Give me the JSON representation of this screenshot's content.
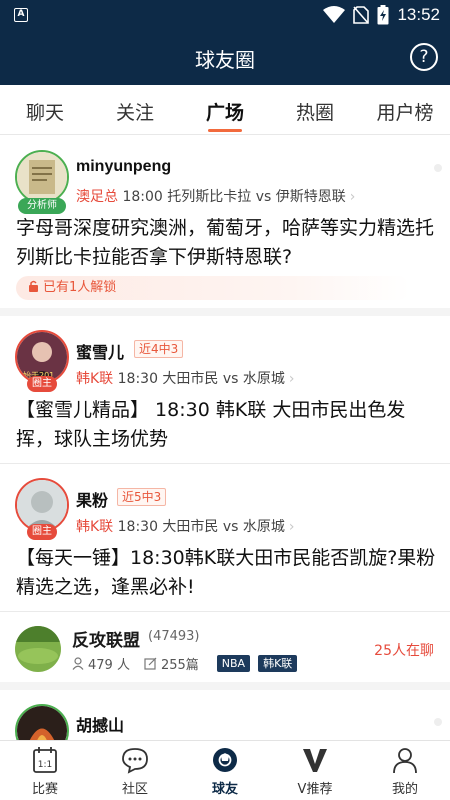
{
  "status_bar": {
    "time": "13:52"
  },
  "header": {
    "title": "球友圈",
    "help_icon": "?"
  },
  "tabs": [
    {
      "label": "聊天",
      "active": false
    },
    {
      "label": "关注",
      "active": false
    },
    {
      "label": "广场",
      "active": true
    },
    {
      "label": "热圈",
      "active": false
    },
    {
      "label": "用户榜",
      "active": false
    }
  ],
  "posts": [
    {
      "username": "minyunpeng",
      "badge": "分析师",
      "league": "澳足总",
      "match": "18:00 托列斯比卡拉 vs 伊斯特恩联",
      "content": "字母哥深度研究澳洲，葡萄牙，哈萨等实力精选托列斯比卡拉能否拿下伊斯特恩联?",
      "unlock_text": "已有1人解锁"
    },
    {
      "username": "蜜雪儿",
      "badge": "圈主",
      "record": "近4中3",
      "league": "韩K联",
      "match": "18:30 大田市民 vs 水原城",
      "content": "【蜜雪儿精品】 18:30 韩K联 大田市民出色发挥，球队主场优势"
    },
    {
      "username": "果粉",
      "badge": "圈主",
      "record": "近5中3",
      "league": "韩K联",
      "match": "18:30 大田市民 vs 水原城",
      "content": "【每天一锤】18:30韩K联大田市民能否凯旋?果粉精选之选，逢黑必补!"
    }
  ],
  "circle": {
    "name": "反攻联盟",
    "count": "(47493)",
    "members": "479 人",
    "posts": "255篇",
    "tags": [
      "NBA",
      "韩K联"
    ],
    "online": "25人在聊"
  },
  "last_post": {
    "username": "胡撼山"
  },
  "bottom_nav": [
    {
      "label": "比赛",
      "icon": "calendar-icon"
    },
    {
      "label": "社区",
      "icon": "chat-bubble-icon"
    },
    {
      "label": "球友",
      "icon": "football-icon",
      "active": true
    },
    {
      "label": "V推荐",
      "icon": "v-icon"
    },
    {
      "label": "我的",
      "icon": "person-icon"
    }
  ],
  "colors": {
    "header_bg": "#0d2a47",
    "accent": "#f26a3d",
    "league_red": "#e64b3c",
    "analyst_green": "#3aa757"
  }
}
